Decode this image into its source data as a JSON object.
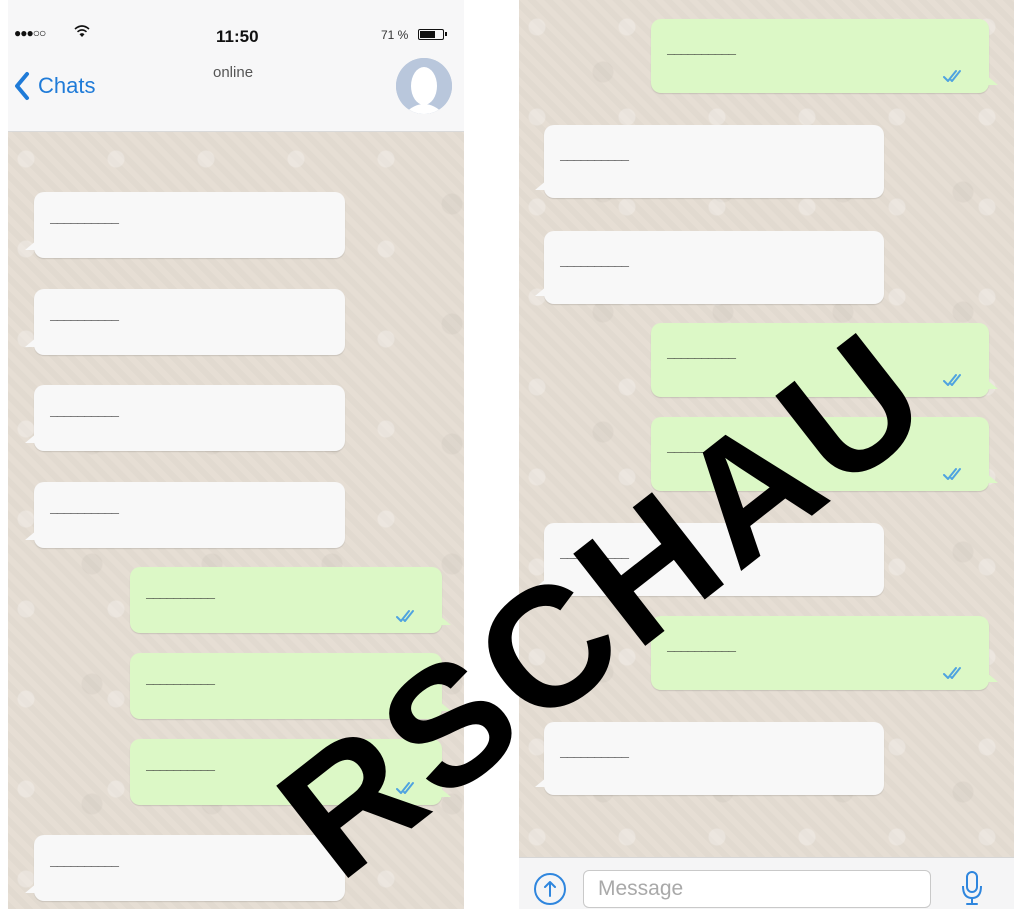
{
  "status_bar": {
    "signal": "●●●○○",
    "time": "11:50",
    "battery_text": "71 %",
    "battery_level": 0.71
  },
  "header": {
    "back_label": "Chats",
    "contact_status": "online"
  },
  "left_messages": [
    {
      "direction": "in",
      "text": "__________"
    },
    {
      "direction": "in",
      "text": "__________"
    },
    {
      "direction": "in",
      "text": "__________"
    },
    {
      "direction": "in",
      "text": "__________"
    },
    {
      "direction": "out",
      "text": "__________",
      "read": true
    },
    {
      "direction": "out",
      "text": "__________",
      "read": true
    },
    {
      "direction": "out",
      "text": "__________",
      "read": true
    },
    {
      "direction": "in",
      "text": "__________"
    }
  ],
  "right_messages": [
    {
      "direction": "out",
      "text": "__________",
      "read": true
    },
    {
      "direction": "in",
      "text": "__________"
    },
    {
      "direction": "in",
      "text": "__________"
    },
    {
      "direction": "out",
      "text": "__________",
      "read": true
    },
    {
      "direction": "out",
      "text": "__________",
      "read": true
    },
    {
      "direction": "in",
      "text": "__________"
    },
    {
      "direction": "out",
      "text": "__________",
      "read": true
    },
    {
      "direction": "in",
      "text": "__________"
    }
  ],
  "composer": {
    "placeholder": "Message"
  },
  "watermark": "RSCHAU",
  "colors": {
    "accent": "#1f7bd8",
    "bubble_out": "#dcf8c6",
    "bubble_in": "#f8f8f8",
    "chat_background": "#e5ddd3",
    "read_ticks": "#4fa3e0",
    "watermark": "#000000"
  },
  "icons": {
    "back": "chevron-left-icon",
    "avatar": "person-silhouette",
    "attach": "arrow-up-circle-icon",
    "mic": "microphone-icon",
    "read": "double-check-icon"
  }
}
